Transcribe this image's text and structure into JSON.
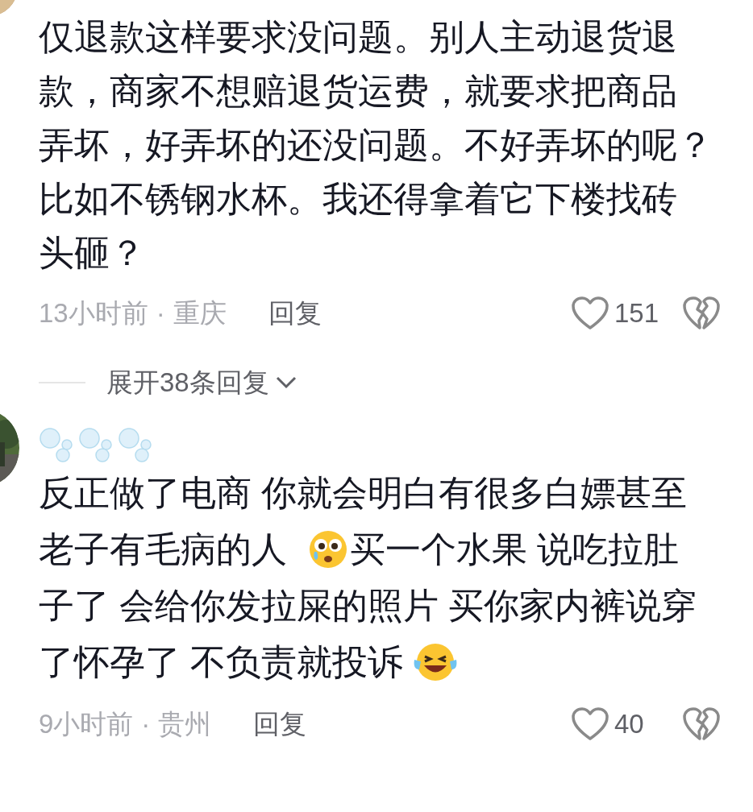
{
  "comments": [
    {
      "lines": [
        [
          {
            "kind": "text",
            "text": "仅退款这样要求没问题。别人主动退货退"
          }
        ],
        [
          {
            "kind": "text",
            "text": "款，商家不想赔退货运费，就要求把商品"
          }
        ],
        [
          {
            "kind": "text",
            "text": "弄坏，好弄坏的还没问题。不好弄坏的呢？"
          }
        ],
        [
          {
            "kind": "text",
            "text": "比如不锈钢水杯。我还得拿着它下楼找砖"
          }
        ],
        [
          {
            "kind": "text",
            "text": "头砸？"
          }
        ]
      ],
      "time": "13小时前",
      "separator": "·",
      "location": "重庆",
      "reply": "回复",
      "likes": "151",
      "replies": "展开38条回复"
    },
    {
      "lines": [
        [
          {
            "kind": "text",
            "text": "反正做了电商 你就会明白有很多白嫖甚至"
          }
        ],
        [
          {
            "kind": "text",
            "text": "老子有毛病的人"
          },
          {
            "kind": "scared_emoji"
          },
          {
            "kind": "text",
            "text": "买一个水果 说吃拉肚"
          }
        ],
        [
          {
            "kind": "text",
            "text": "子了 会给你发拉屎的照片 买你家内裤说穿"
          }
        ],
        [
          {
            "kind": "text",
            "text": "了怀孕了 不负责就投诉"
          },
          {
            "kind": "laugh_emoji"
          }
        ]
      ],
      "time": "9小时前",
      "separator": "·",
      "location": "贵州",
      "reply": "回复",
      "likes": "40"
    }
  ]
}
